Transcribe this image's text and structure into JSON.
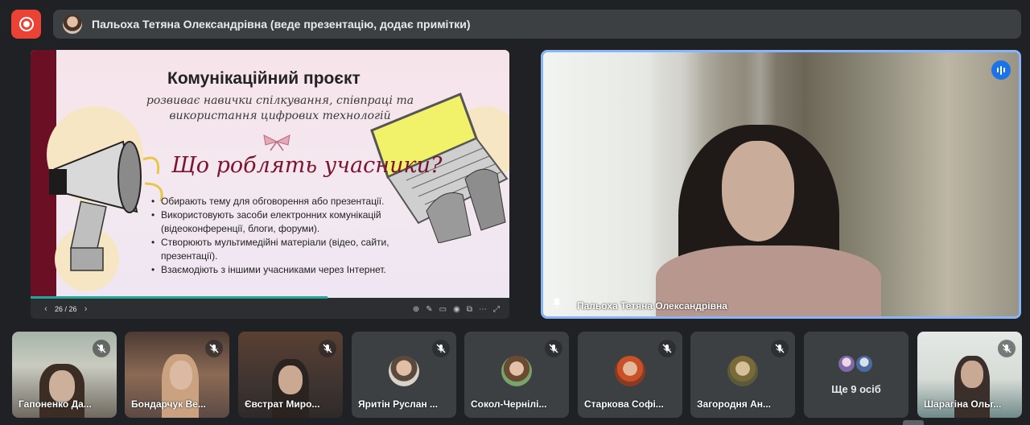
{
  "presenter_banner": {
    "text": "Пальоха Тетяна Олександрівна (веде презентацію, додає примітки)"
  },
  "icons": {
    "record": "record-icon",
    "speaking": "speaking-indicator-icon",
    "pin": "pin-icon",
    "mic_off": "mic-off-icon"
  },
  "colors": {
    "record_button": "#ea4335",
    "active_speaker_border": "#8ab4f8",
    "speaking_badge": "#1a73e8",
    "slide_heading": "#7a1530",
    "slide_band": "#6b1024"
  },
  "slide": {
    "title": "Комунікаційний проєкт",
    "subtitle": "розвиває навички спілкування, співпраці та використання цифрових технологій",
    "heading": "Що роблять учасники?",
    "bullets": [
      "Обирають тему для обговорення або презентації.",
      "Використовують засоби електронних комунікацій (відеоконференції, блоги, форуми).",
      "Створюють мультимедійні матеріали (відео, сайти, презентації).",
      "Взаємодіють з іншими учасниками через Інтернет."
    ],
    "page_indicator": "26 / 26",
    "progress": 0.62
  },
  "speaker": {
    "name": "Пальоха Тетяна Олександрівна"
  },
  "participants": [
    {
      "name": "Гапоненко Да...",
      "type": "video"
    },
    {
      "name": "Бондарчук Ве...",
      "type": "video"
    },
    {
      "name": "Євстрат Миро...",
      "type": "video"
    },
    {
      "name": "Яритін Руслан ...",
      "type": "avatar"
    },
    {
      "name": "Сокол-Чернілі...",
      "type": "avatar"
    },
    {
      "name": "Старкова Софі...",
      "type": "avatar"
    },
    {
      "name": "Загородня Ан...",
      "type": "avatar"
    }
  ],
  "more_people": {
    "label": "Ще 9 осіб"
  },
  "last_participant": {
    "name": "Шарагіна Ольг..."
  }
}
